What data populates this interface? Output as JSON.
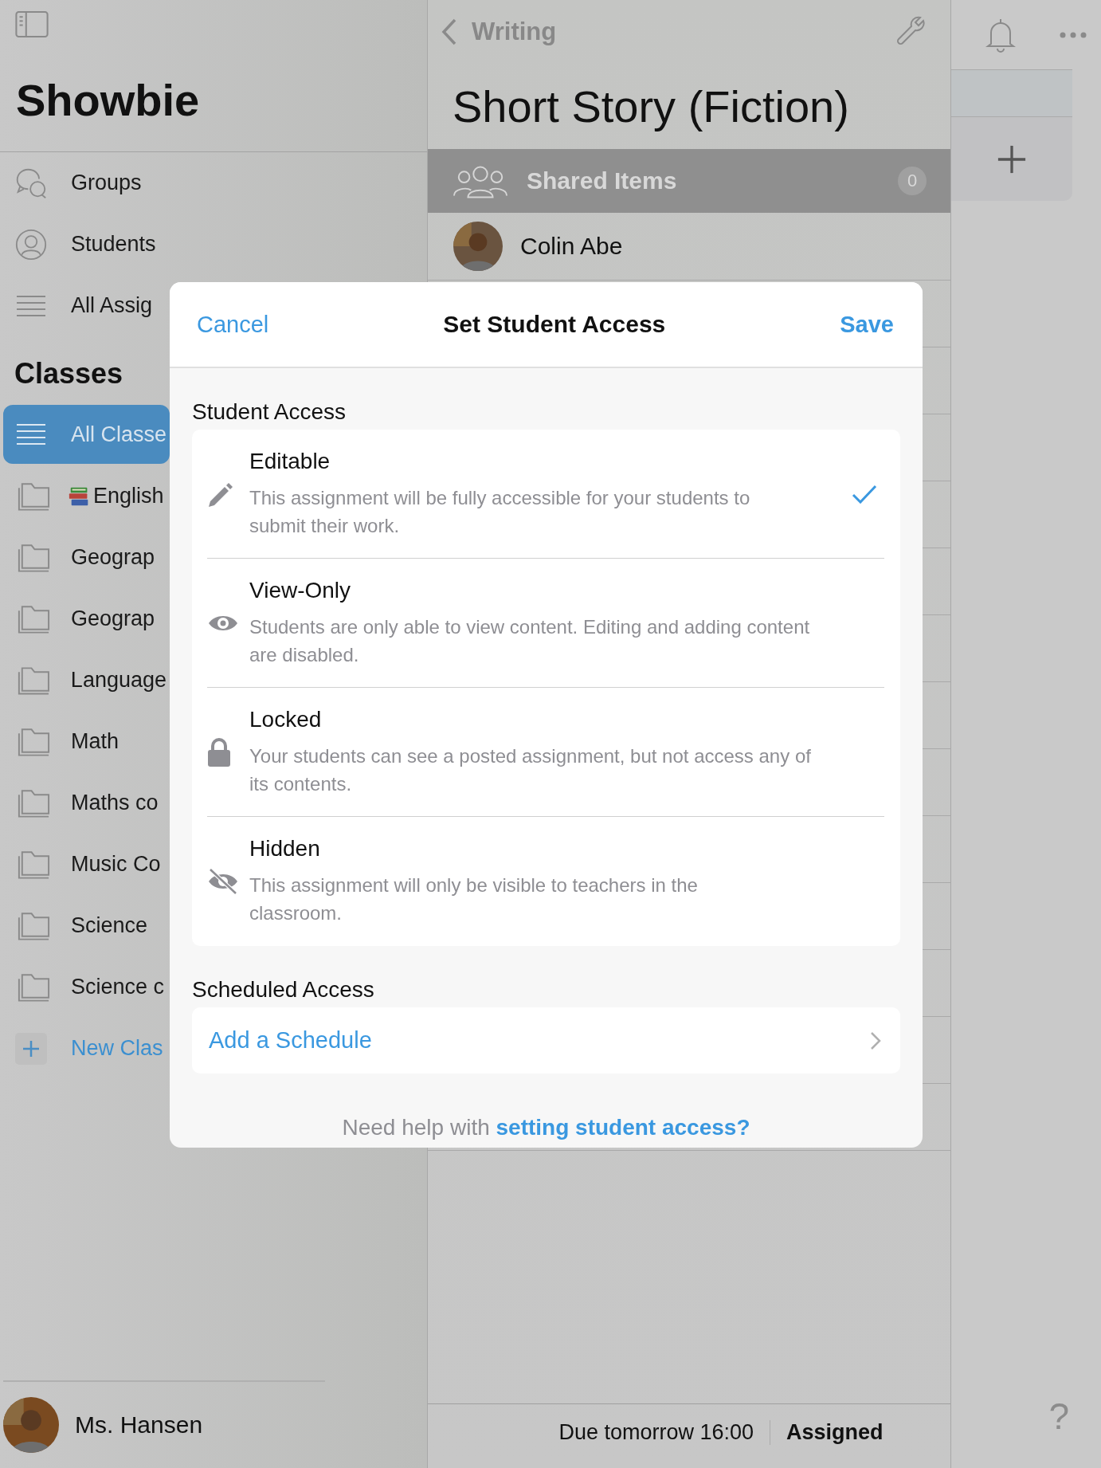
{
  "sidebar": {
    "title": "Showbie",
    "nav": [
      {
        "label": "Groups"
      },
      {
        "label": "Students"
      },
      {
        "label": "All Assig"
      }
    ],
    "classes_header": "Classes",
    "classes": [
      {
        "label": "All Classe",
        "kind": "all",
        "selected": true
      },
      {
        "label": "English",
        "kind": "books",
        "selected": false
      },
      {
        "label": "Geograp",
        "kind": "folder",
        "selected": false
      },
      {
        "label": "Geograp",
        "kind": "folder",
        "selected": false
      },
      {
        "label": "Language",
        "kind": "folder",
        "selected": false
      },
      {
        "label": "Math",
        "kind": "folder",
        "selected": false
      },
      {
        "label": "Maths co",
        "kind": "folder",
        "selected": false
      },
      {
        "label": "Music Co",
        "kind": "folder",
        "selected": false
      },
      {
        "label": "Science",
        "kind": "folder",
        "selected": false
      },
      {
        "label": "Science c",
        "kind": "folder",
        "selected": false
      }
    ],
    "new_class": "New Clas",
    "user": {
      "name": "Ms. Hansen"
    }
  },
  "assignment": {
    "back": "Writing",
    "title": "Short Story (Fiction)",
    "shared_items": {
      "label": "Shared Items",
      "count": "0"
    },
    "students": [
      {
        "name": "Colin Abe"
      }
    ],
    "due": "Due tomorrow 16:00",
    "status": "Assigned"
  },
  "help": "?",
  "dialog": {
    "cancel": "Cancel",
    "title": "Set Student Access",
    "save": "Save",
    "section": "Student Access",
    "options": [
      {
        "kind": "editable",
        "title": "Editable",
        "description": "This assignment will be fully accessible for your students to submit their work.",
        "selected": true
      },
      {
        "kind": "view_only",
        "title": "View-Only",
        "description": "Students are only able to view content. Editing and adding content are disabled.",
        "selected": false
      },
      {
        "kind": "locked",
        "title": "Locked",
        "description": "Your students can see a posted assignment, but not access any of its contents.",
        "selected": false
      },
      {
        "kind": "hidden",
        "title": "Hidden",
        "description": "This assignment will only be visible to teachers in the classroom.",
        "selected": false
      }
    ],
    "scheduled_section": "Scheduled Access",
    "schedule_link": "Add a Schedule",
    "help_text": "Need help with",
    "help_link": "setting student access?"
  }
}
